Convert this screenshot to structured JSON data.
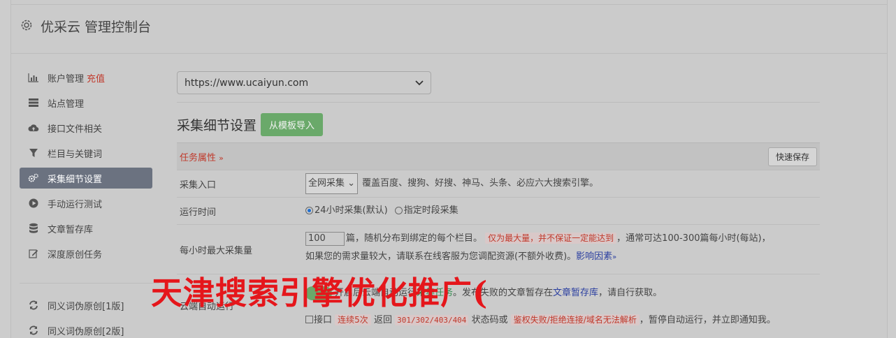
{
  "header": {
    "title": "优采云 管理控制台"
  },
  "sidebar": {
    "items": [
      {
        "label": "账户管理",
        "badge": "充值",
        "icon": "bar-chart-icon"
      },
      {
        "label": "站点管理",
        "icon": "server-icon"
      },
      {
        "label": "接口文件相关",
        "icon": "cloud-upload-icon"
      },
      {
        "label": "栏目与关键词",
        "icon": "filter-icon"
      },
      {
        "label": "采集细节设置",
        "icon": "gears-icon",
        "active": true
      },
      {
        "label": "手动运行测试",
        "icon": "play-circle-icon"
      },
      {
        "label": "文章暂存库",
        "icon": "database-icon"
      },
      {
        "label": "深度原创任务",
        "icon": "edit-icon"
      },
      {
        "label": "同义词伪原创[1版]",
        "icon": "refresh-icon"
      },
      {
        "label": "同义词伪原创[2版]",
        "icon": "refresh-icon"
      }
    ]
  },
  "main": {
    "site_select": "https://www.ucaiyun.com",
    "section_title": "采集细节设置",
    "import_button": "从模板导入",
    "props_label": "任务属性",
    "quick_save": "快速保存",
    "rows": {
      "entry": {
        "label": "采集入口",
        "select": "全网采集",
        "desc": "覆盖百度、搜狗、好搜、神马、头条、必应六大搜索引擎。"
      },
      "runtime": {
        "label": "运行时间",
        "opt1": "24小时采集(默认)",
        "opt2": "指定时段采集"
      },
      "maxrate": {
        "label": "每小时最大采集量",
        "value": "100",
        "text1": "篇，随机分布到绑定的每个栏目。",
        "tag": "仅为最大量，并不保证一定能达到",
        "text2": "，通常可达100-300篇每小时(每站)，",
        "text3": "如果您的需求量较大，请联系在线客服为您调配资源(不额外收费)。",
        "link": "影响因素"
      },
      "cloud": {
        "label": "云端自动运行",
        "text1": "开启后云端自动运行",
        "green": "采集任务",
        "text2": "。发布失败的文章暂存在",
        "link": "文章暂存库",
        "text3": "，请自行获取。",
        "cb_label": "接口",
        "tag1": "连续5次",
        "text4": "返回",
        "codes": "301/302/403/404",
        "text5": "状态码或",
        "tag2": "鉴权失败/拒绝连接/域名无法解析",
        "text6": "，暂停自动运行，并立即通知我。"
      }
    }
  },
  "overlay_text": "天津搜索引擎优化推广("
}
